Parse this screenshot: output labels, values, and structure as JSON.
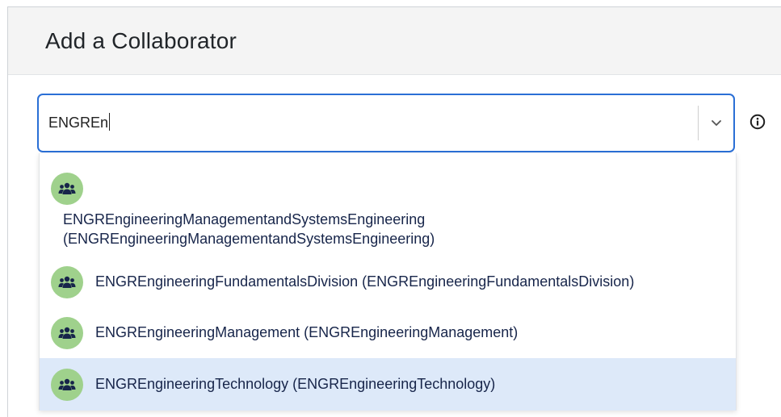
{
  "dialog": {
    "title": "Add a Collaborator"
  },
  "search": {
    "value": "ENGREn"
  },
  "icons": {
    "toggle": "chevron-down-icon",
    "info": "info-icon",
    "group": "group-icon"
  },
  "colors": {
    "accent": "#2a6fd6",
    "avatar_bg": "#9fd18c",
    "highlight_bg": "#dde9f9",
    "option_text": "#17254a"
  },
  "options": [
    {
      "line1": "ENGREngineeringManagementandSystemsEngineering",
      "line2": "(ENGREngineeringManagementandSystemsEngineering)"
    },
    {
      "label": "ENGREngineeringFundamentalsDivision (ENGREngineeringFundamentalsDivision)"
    },
    {
      "label": "ENGREngineeringManagement (ENGREngineeringManagement)"
    },
    {
      "label": "ENGREngineeringTechnology (ENGREngineeringTechnology)",
      "highlighted": true
    }
  ]
}
